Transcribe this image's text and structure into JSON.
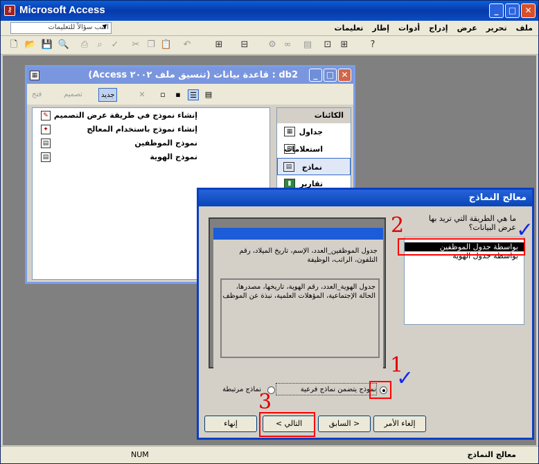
{
  "app": {
    "title": "Microsoft Access"
  },
  "menubar": {
    "help_placeholder": "اكتب سؤالاً للتعليمات",
    "menus": [
      "ملف",
      "تحرير",
      "عرض",
      "إدراج",
      "أدوات",
      "إطار",
      "تعليمات"
    ]
  },
  "dbwindow": {
    "title": "db2 : قاعدة بيانات (تنسيق ملف ٢٠٠٢ Access)",
    "toolbar": {
      "open": "فتح",
      "design": "تصميم",
      "new": "جديد"
    },
    "items": [
      "إنشاء نموذج في طريقة عرض التصميم",
      "إنشاء نموذج باستخدام المعالج",
      "نموذج الموظفين",
      "نموذج الهوية"
    ],
    "objects_header": "الكائنات",
    "objects": [
      "جداول",
      "استعلامات",
      "نماذج",
      "تقارير"
    ]
  },
  "wizard": {
    "title": "معالج النماذج",
    "question": "ما هي الطريقة التي تريد بها عرض البيانات؟",
    "options": [
      "بواسطة جدول الموظفين",
      "بواسطة جدول الهوية"
    ],
    "preview_text1": "جدول الموظفين_العدد، الإسم، تاريخ الميلاد، رقم التلفون، الراتب، الوظيفة",
    "preview_text2": "جدول الهوية_العدد، رقم الهوية، تاريخها، مصدرها، الحالة الإجتماعية، المؤهلات العلمية، نبذة عن الموظف",
    "radio1": "نموذج يتضمن نماذج فرعية",
    "radio2": "نماذج مرتبطة",
    "buttons": {
      "cancel": "إلغاء الأمر",
      "back": "< السابق",
      "next": "التالي >",
      "finish": "إنهاء"
    }
  },
  "statusbar": {
    "text": "معالج النماذج",
    "num": "NUM"
  },
  "annotations": {
    "n1": "1",
    "n2": "2",
    "n3": "3",
    "check": "✓"
  }
}
